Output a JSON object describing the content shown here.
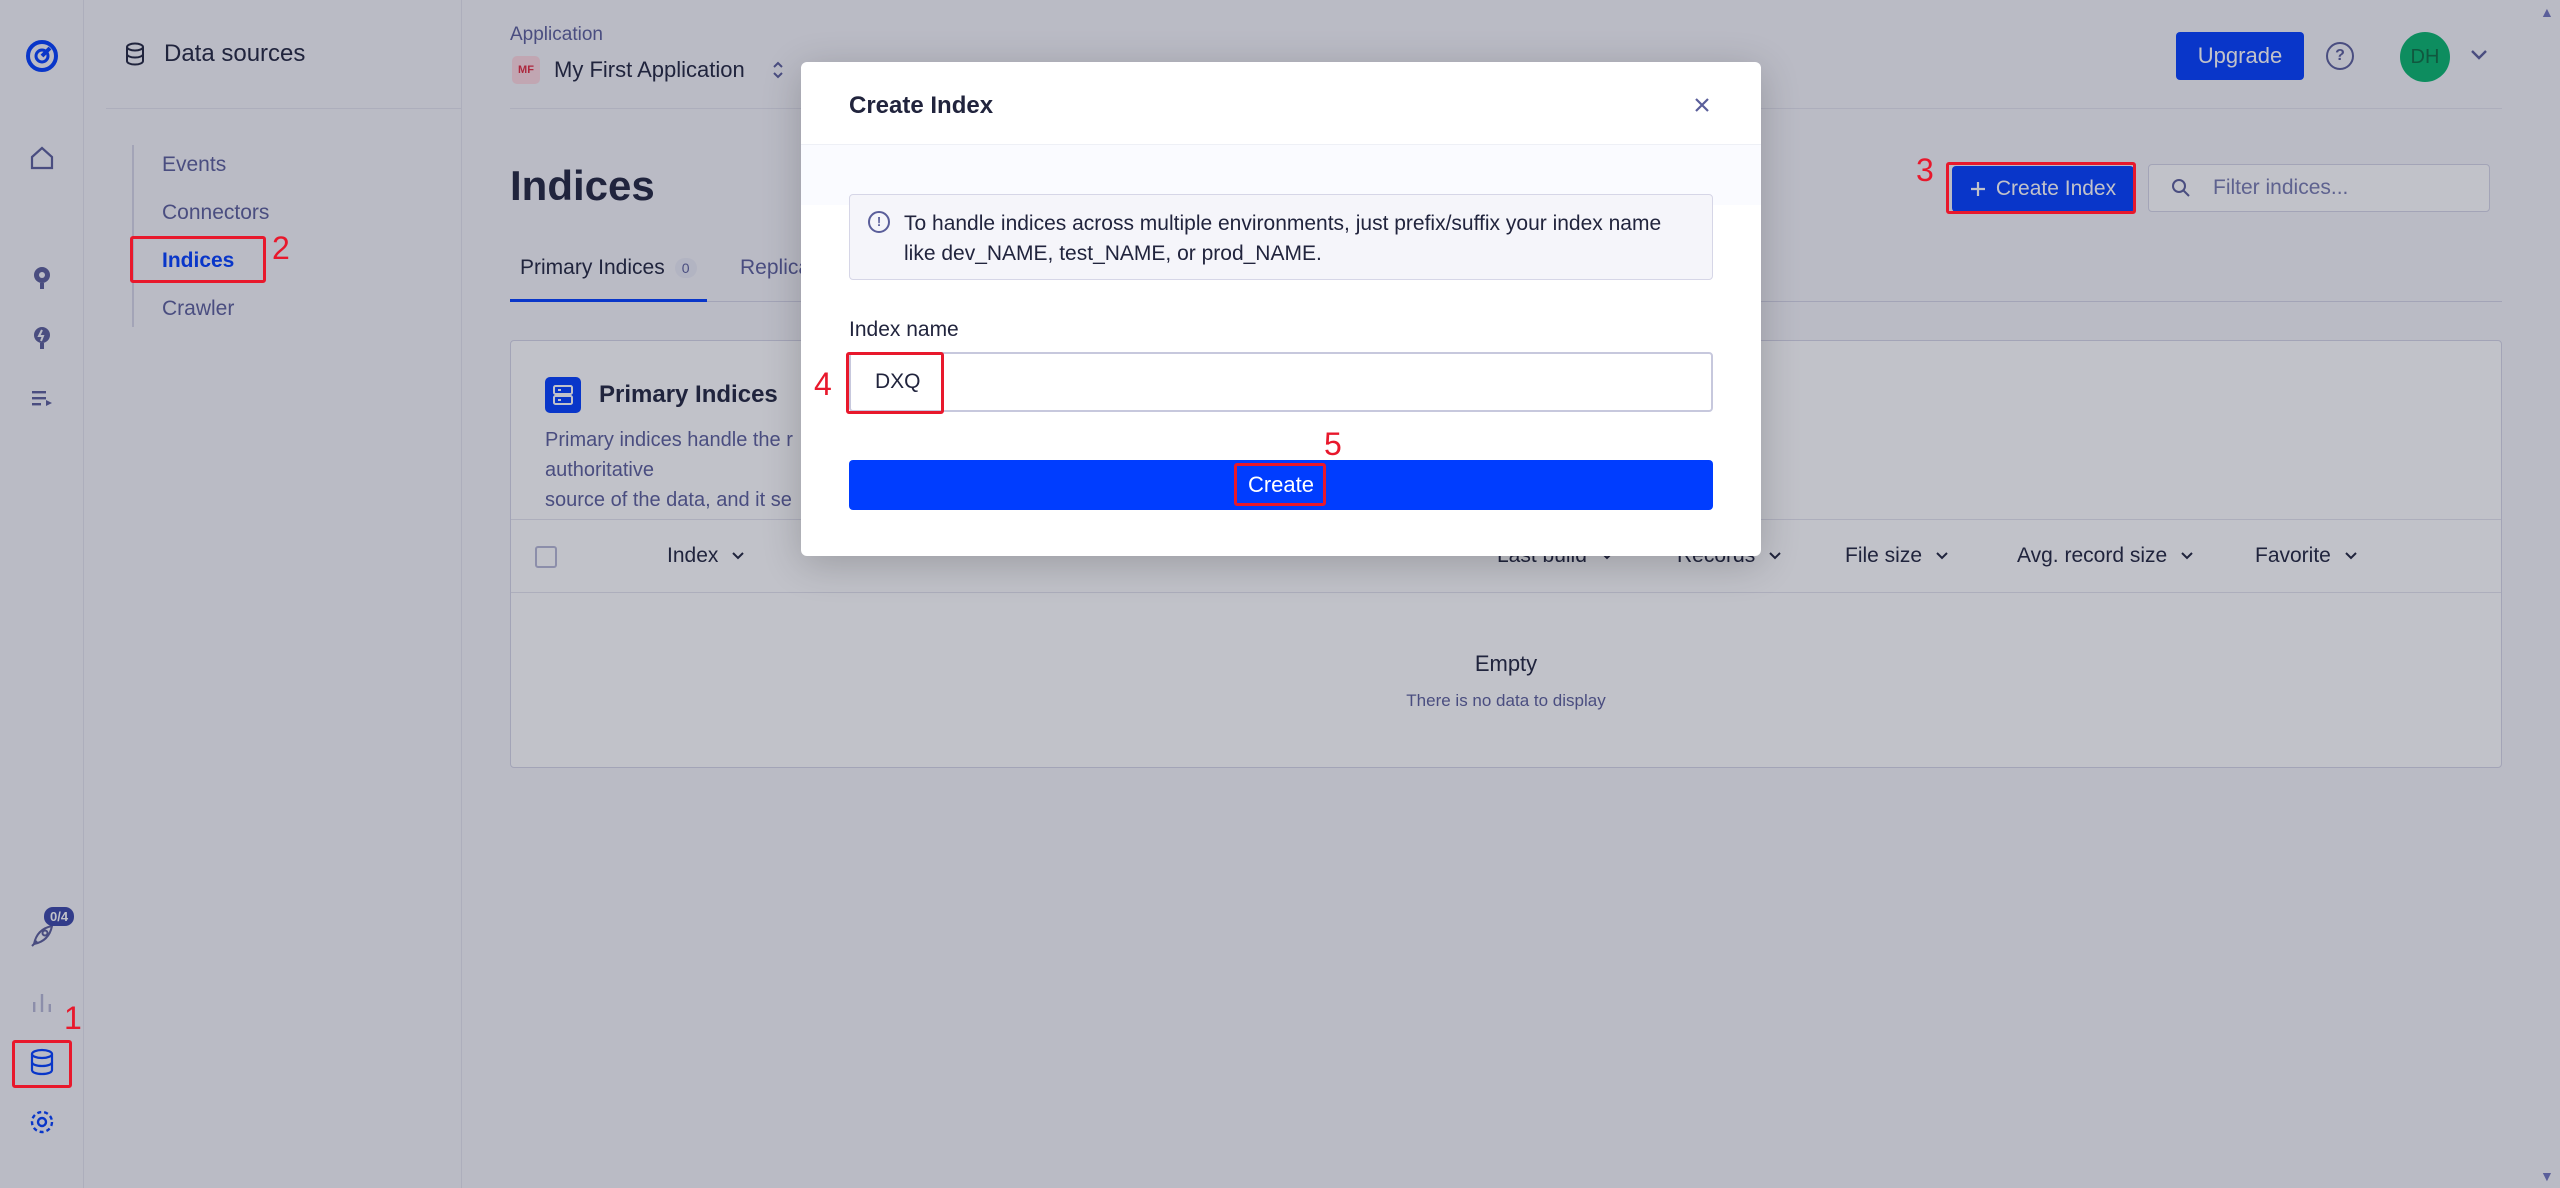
{
  "rail": {
    "onboarding_badge": "0/4"
  },
  "sidebar": {
    "title": "Data sources",
    "items": [
      {
        "label": "Events"
      },
      {
        "label": "Connectors"
      },
      {
        "label": "Indices"
      },
      {
        "label": "Crawler"
      }
    ]
  },
  "header": {
    "app_label": "Application",
    "app_badge": "MF",
    "app_name": "My First Application",
    "upgrade_label": "Upgrade",
    "help_icon": "?",
    "avatar_initials": "DH"
  },
  "main": {
    "title": "Indices",
    "create_index_label": "Create Index",
    "filter_placeholder": "Filter indices...",
    "tabs": [
      {
        "label": "Primary Indices",
        "count": "0"
      },
      {
        "label": "Replica"
      }
    ],
    "panel": {
      "title": "Primary Indices",
      "description_start": "Primary indices handle the r",
      "description_end": "authoritative",
      "description_line2": "source of the data, and it se"
    },
    "columns": [
      "Index",
      "Last build",
      "Records",
      "File size",
      "Avg. record size",
      "Favorite"
    ],
    "empty_title": "Empty",
    "empty_subtitle": "There is no data to display"
  },
  "modal": {
    "title": "Create Index",
    "info": "To handle indices across multiple environments, just prefix/suffix your index name like dev_NAME, test_NAME, or prod_NAME.",
    "field_label": "Index name",
    "field_value": "DXQ",
    "create_label": "Create"
  },
  "annotations": [
    "1",
    "2",
    "3",
    "4",
    "5"
  ],
  "colors": {
    "accent": "#003dff",
    "annotation": "#e8182c",
    "avatar": "#06b66c"
  }
}
